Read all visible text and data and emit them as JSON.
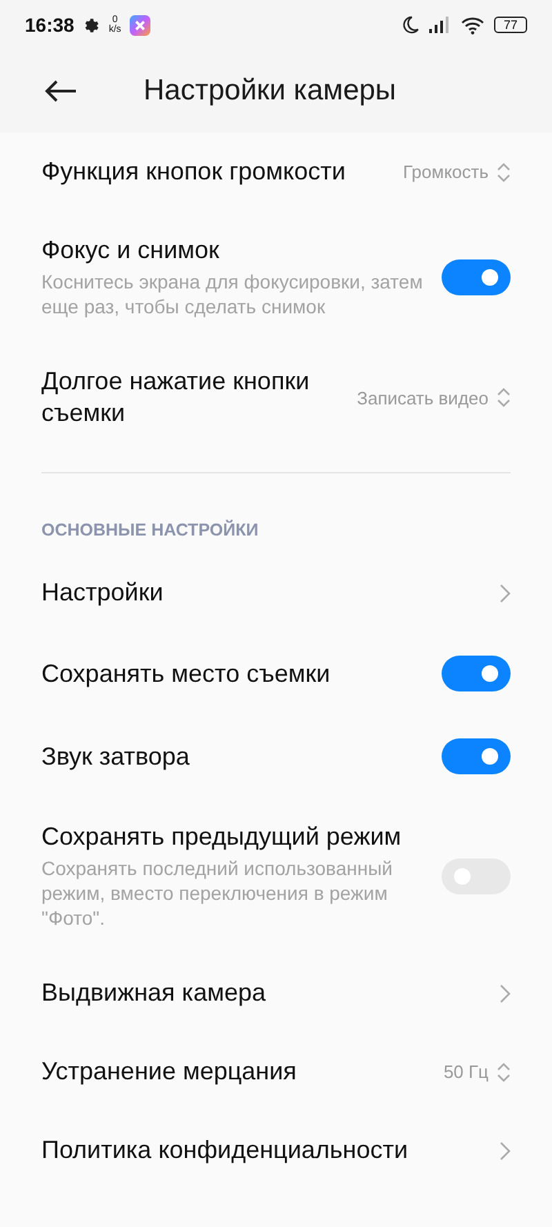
{
  "status_bar": {
    "time": "16:38",
    "net_speed_value": "0",
    "net_speed_unit": "k/s",
    "battery": "77"
  },
  "header": {
    "title": "Настройки камеры"
  },
  "sections": [
    {
      "items": [
        {
          "kind": "select",
          "label": "Функция кнопок громкости",
          "value": "Громкость"
        },
        {
          "kind": "toggle",
          "label": "Фокус и снимок",
          "subtitle": "Коснитесь экрана для фокусировки, затем еще раз, чтобы сделать снимок",
          "on": true
        },
        {
          "kind": "select",
          "label": "Долгое нажатие кнопки съемки",
          "value": "Записать видео"
        }
      ]
    },
    {
      "header": "ОСНОВНЫЕ НАСТРОЙКИ",
      "items": [
        {
          "kind": "link",
          "label": "Настройки"
        },
        {
          "kind": "toggle",
          "label": "Сохранять место съемки",
          "on": true
        },
        {
          "kind": "toggle",
          "label": "Звук затвора",
          "on": true
        },
        {
          "kind": "toggle",
          "label": "Сохранять предыдущий режим",
          "subtitle": "Сохранять последний использованный режим, вместо переключения в режим \"Фото\".",
          "on": false
        },
        {
          "kind": "link",
          "label": "Выдвижная камера"
        },
        {
          "kind": "select",
          "label": "Устранение мерцания",
          "value": "50 Гц"
        },
        {
          "kind": "link",
          "label": "Политика конфиденциальности"
        }
      ]
    }
  ]
}
